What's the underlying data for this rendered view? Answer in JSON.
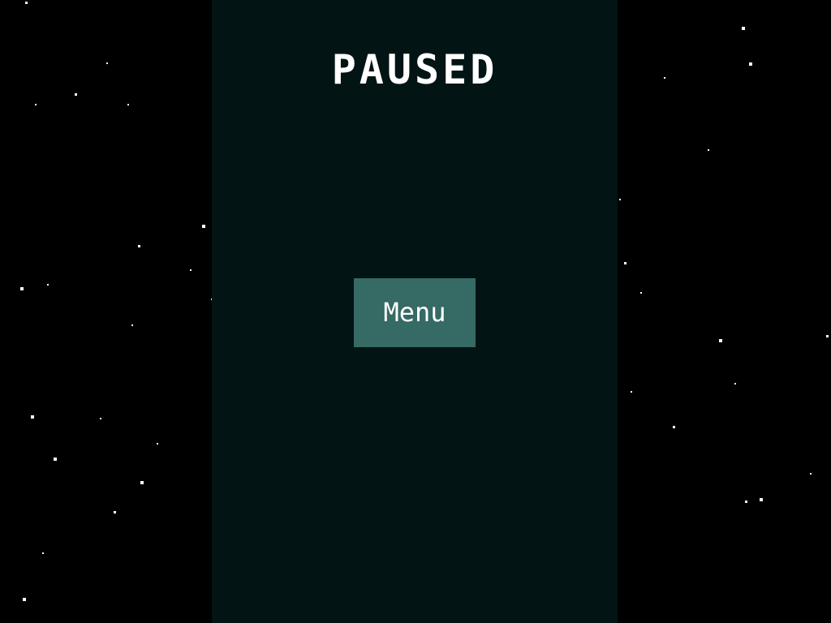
{
  "pause_screen": {
    "title": "PAUSED",
    "menu_button_label": "Menu"
  },
  "colors": {
    "background": "#000000",
    "panel": "#021414",
    "button": "#366a64",
    "text": "#ffffff",
    "star": "#ffffff"
  }
}
